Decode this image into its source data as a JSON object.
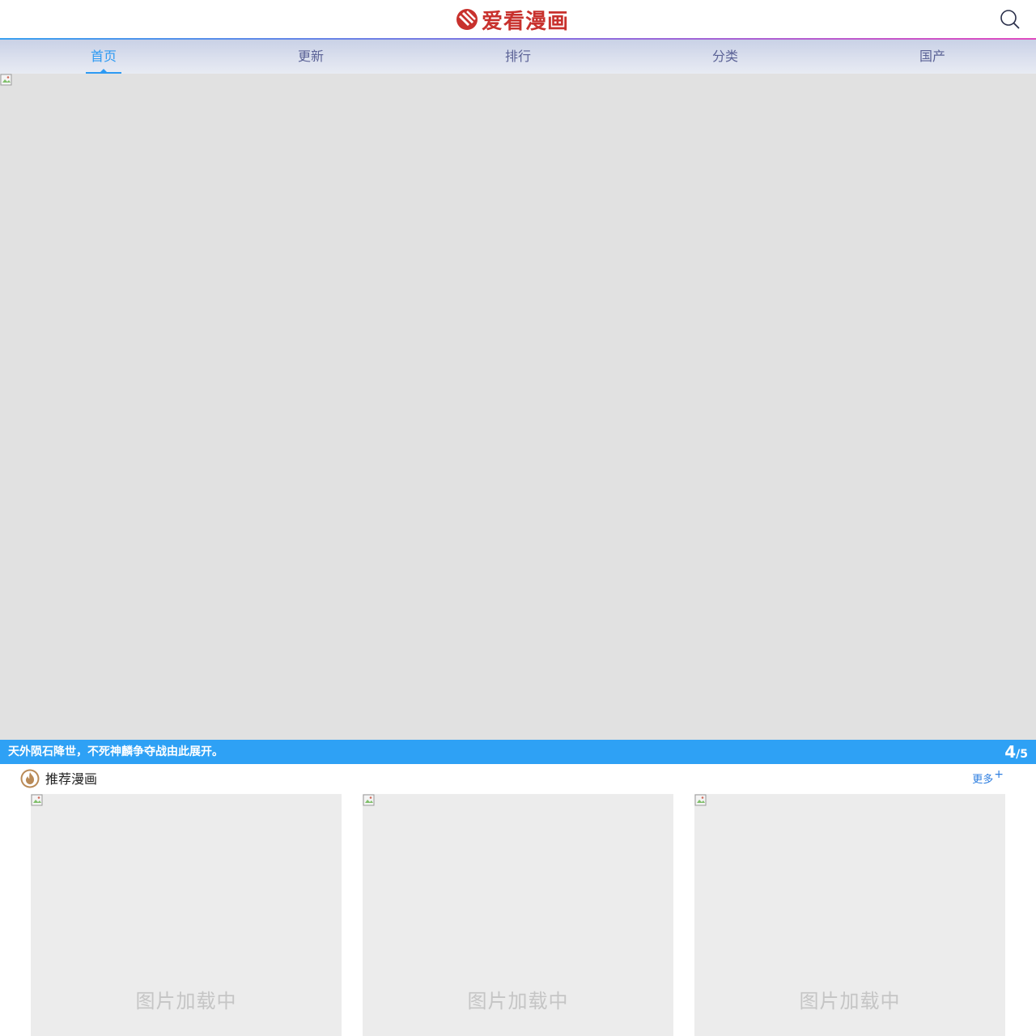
{
  "header": {
    "logo_text": "爱看漫画",
    "brand_color": "#c8312d",
    "search_icon": "search-icon"
  },
  "nav": {
    "items": [
      {
        "label": "首页",
        "active": true
      },
      {
        "label": "更新",
        "active": false
      },
      {
        "label": "排行",
        "active": false
      },
      {
        "label": "分类",
        "active": false
      },
      {
        "label": "国产",
        "active": false
      }
    ],
    "active_color": "#2d9af3"
  },
  "banner": {
    "caption": "天外陨石降世，不死神麟争夺战由此展开。",
    "current_slide": "4",
    "separator": "/",
    "total_slides": "5",
    "caption_bg": "#2ea1f5"
  },
  "section": {
    "title": "推荐漫画",
    "more_label": "更多",
    "more_suffix": "+",
    "icon": "fire-icon"
  },
  "cards": [
    {
      "loading_text": "图片加载中"
    },
    {
      "loading_text": "图片加载中"
    },
    {
      "loading_text": "图片加载中"
    }
  ]
}
